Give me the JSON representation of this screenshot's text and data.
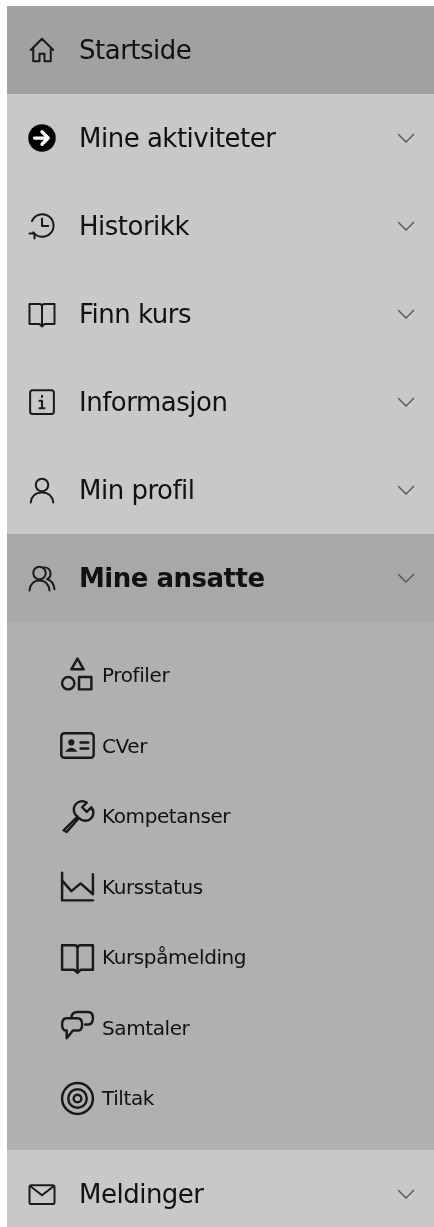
{
  "menu": [
    {
      "label": "Startside",
      "kind": "link",
      "selected": true
    },
    {
      "label": "Mine aktiviteter",
      "kind": "group",
      "expanded": false
    },
    {
      "label": "Historikk",
      "kind": "group",
      "expanded": false
    },
    {
      "label": "Finn kurs",
      "kind": "group",
      "expanded": false
    },
    {
      "label": "Informasjon",
      "kind": "group",
      "expanded": false
    },
    {
      "label": "Min profil",
      "kind": "group",
      "expanded": false
    },
    {
      "label": "Mine ansatte",
      "kind": "group",
      "expanded": true,
      "children": [
        {
          "label": "Profiler"
        },
        {
          "label": "CVer"
        },
        {
          "label": "Kompetanser"
        },
        {
          "label": "Kursstatus"
        },
        {
          "label": "Kurspåmelding"
        },
        {
          "label": "Samtaler"
        },
        {
          "label": "Tiltak"
        }
      ]
    },
    {
      "label": "Meldinger",
      "kind": "group",
      "expanded": false
    }
  ]
}
